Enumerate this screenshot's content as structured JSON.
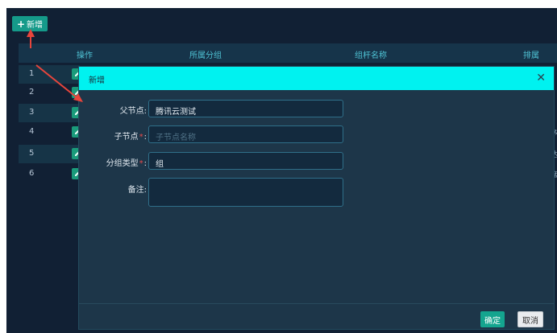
{
  "toolbar": {
    "add_label": "新增",
    "add_icon": "plus-icon"
  },
  "table": {
    "headers": [
      "操作",
      "所属分组",
      "组杆名称",
      "排属"
    ],
    "rows": [
      "1",
      "2",
      "3",
      "4",
      "5",
      "6"
    ],
    "right_fragments": [
      "a",
      "s",
      "s",
      "矛",
      "达",
      "席"
    ]
  },
  "modal": {
    "title": "新增",
    "fields": [
      {
        "label": "父节点:",
        "value": "腾讯云测试"
      },
      {
        "label": "子节点",
        "suffix": ":",
        "placeholder": "子节点名称"
      },
      {
        "label": "分组类型",
        "suffix": ":",
        "value": "组"
      },
      {
        "label": "备注:",
        "value": ""
      }
    ],
    "ok_label": "确定",
    "cancel_label": "取消"
  },
  "colors": {
    "accent": "#00f2f0",
    "primary": "#14a58f",
    "bg": "#112034",
    "required": "#e84a4a",
    "arrow": "#e8453c"
  }
}
